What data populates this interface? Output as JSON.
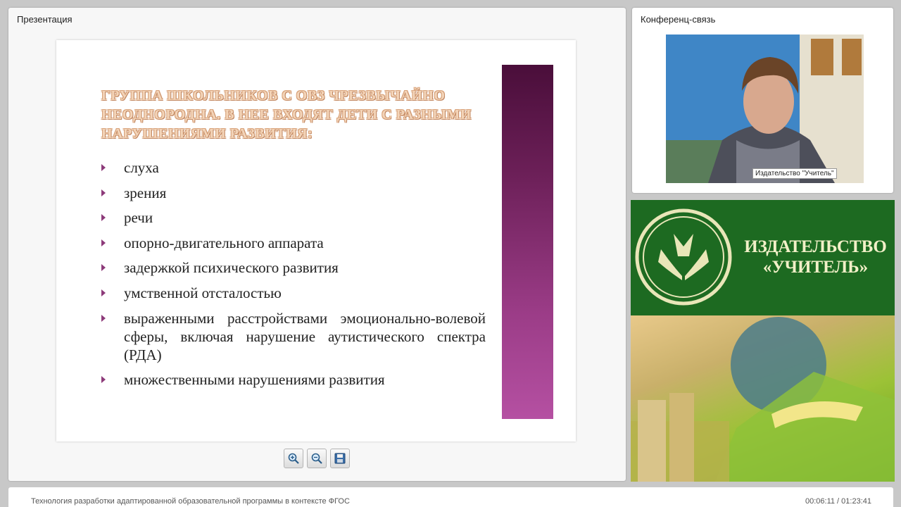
{
  "presentation": {
    "panel_title": "Презентация",
    "slide": {
      "heading": "Группа школьников с ОВЗ чрезвычайно неоднородна. В нее входят дети с разными нарушениями развития:",
      "items": [
        "слуха",
        "зрения",
        "речи",
        "опорно-двигательного аппарата",
        "задержкой психического развития",
        "умственной отсталостью",
        "выраженными расстройствами эмоционально-волевой сферы, включая нарушение аутистического спектра (РДА)",
        "множественными нарушениями развития"
      ]
    },
    "toolbar": {
      "zoom_in_icon": "zoom-in-icon",
      "zoom_out_icon": "zoom-out-icon",
      "save_icon": "save-icon"
    }
  },
  "conference": {
    "panel_title": "Конференц-связь",
    "video_caption": "Издательство \"Учитель\""
  },
  "promo": {
    "publisher_line1": "ИЗДАТЕЛЬСТВО",
    "publisher_line2": "«УЧИТЕЛЬ»",
    "colors": {
      "top": "#1d6a21",
      "text": "#f2f0c8"
    }
  },
  "footer": {
    "title": "Технология разработки адаптированной образовательной программы в контексте ФГОС",
    "time": "00:06:11 / 01:23:41"
  }
}
